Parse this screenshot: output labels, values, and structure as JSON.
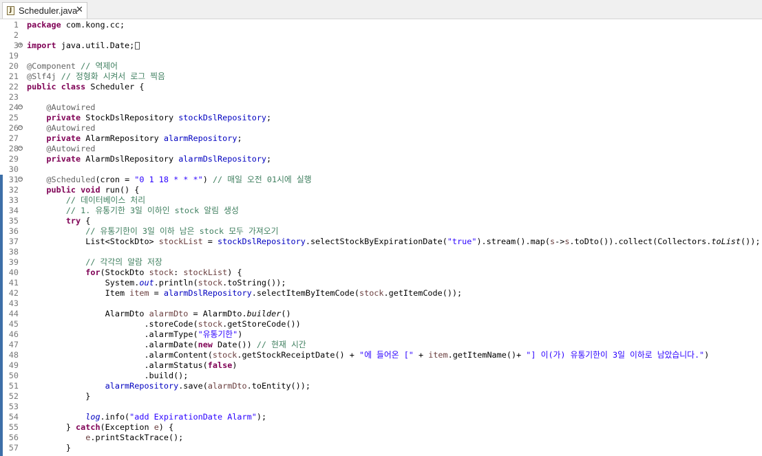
{
  "tab": {
    "icon": "java-file-icon",
    "icon_glyph": "J",
    "title": "Scheduler.java",
    "close": "✕"
  },
  "lines": [
    {
      "n": "1",
      "fold": "",
      "html": "<span class=\"kw\">package</span> com.kong.cc;"
    },
    {
      "n": "2",
      "fold": "",
      "html": ""
    },
    {
      "n": "3",
      "fold": "+",
      "html": "<span class=\"kw\">import</span> java.util.Date;<span class=\"boxmark\"></span>"
    },
    {
      "n": "19",
      "fold": "",
      "html": ""
    },
    {
      "n": "20",
      "fold": "",
      "html": "<span class=\"ann\">@Component</span> <span class=\"cm\">// 역제어</span>"
    },
    {
      "n": "21",
      "fold": "",
      "html": "<span class=\"ann\">@Slf4j</span> <span class=\"cm\">// 정형화 시켜서 로그 찍음</span>"
    },
    {
      "n": "22",
      "fold": "",
      "html": "<span class=\"kw\">public class</span> Scheduler {"
    },
    {
      "n": "23",
      "fold": "",
      "html": ""
    },
    {
      "n": "24",
      "fold": "−",
      "html": "    <span class=\"ann\">@Autowired</span>"
    },
    {
      "n": "25",
      "fold": "",
      "html": "    <span class=\"kw\">private</span> StockDslRepository <span class=\"fld\">stockDslRepository</span>;"
    },
    {
      "n": "26",
      "fold": "−",
      "html": "    <span class=\"ann\">@Autowired</span>"
    },
    {
      "n": "27",
      "fold": "",
      "html": "    <span class=\"kw\">private</span> AlarmRepository <span class=\"fld\">alarmRepository</span>;"
    },
    {
      "n": "28",
      "fold": "−",
      "html": "    <span class=\"ann\">@Autowired</span>"
    },
    {
      "n": "29",
      "fold": "",
      "html": "    <span class=\"kw\">private</span> AlarmDslRepository <span class=\"fld\">alarmDslRepository</span>;"
    },
    {
      "n": "30",
      "fold": "",
      "html": ""
    },
    {
      "n": "31",
      "fold": "−",
      "html": "    <span class=\"ann\">@Scheduled</span>(cron = <span class=\"str\">\"0 1 18 * * *\"</span>) <span class=\"cm\">// 매일 오전 01시에 실행</span>"
    },
    {
      "n": "32",
      "fold": "",
      "html": "    <span class=\"kw\">public void</span> run() {"
    },
    {
      "n": "33",
      "fold": "",
      "html": "        <span class=\"cm\">// 데이터베이스 처리</span>"
    },
    {
      "n": "34",
      "fold": "",
      "html": "        <span class=\"cm\">// 1. 유통기한 3일 이하인 stock 알림 생성</span>"
    },
    {
      "n": "35",
      "fold": "",
      "html": "        <span class=\"kw\">try</span> {"
    },
    {
      "n": "36",
      "fold": "",
      "html": "            <span class=\"cm\">// 유통기한이 3일 이하 남은 stock 모두 가져오기</span>"
    },
    {
      "n": "37",
      "fold": "",
      "html": "            List&lt;StockDto&gt; <span class=\"local\">stockList</span> = <span class=\"fld\">stockDslRepository</span>.selectStockByExpirationDate(<span class=\"str\">\"true\"</span>).stream().map(<span class=\"local\">s</span>-&gt;<span class=\"local\">s</span>.toDto()).collect(Collectors.<span class=\"it\">toList</span>());"
    },
    {
      "n": "38",
      "fold": "",
      "html": ""
    },
    {
      "n": "39",
      "fold": "",
      "html": "            <span class=\"cm\">// 각각의 알람 저장</span>"
    },
    {
      "n": "40",
      "fold": "",
      "html": "            <span class=\"kw\">for</span>(StockDto <span class=\"local\">stock</span>: <span class=\"local\">stockList</span>) {"
    },
    {
      "n": "41",
      "fold": "",
      "html": "                System.<span class=\"fld it\">out</span>.println(<span class=\"local\">stock</span>.toString());"
    },
    {
      "n": "42",
      "fold": "",
      "html": "                Item <span class=\"local\">item</span> = <span class=\"fld\">alarmDslRepository</span>.selectItemByItemCode(<span class=\"local\">stock</span>.getItemCode());"
    },
    {
      "n": "43",
      "fold": "",
      "html": ""
    },
    {
      "n": "44",
      "fold": "",
      "html": "                AlarmDto <span class=\"local\">alarmDto</span> = AlarmDto.<span class=\"it\">builder</span>()"
    },
    {
      "n": "45",
      "fold": "",
      "html": "                        .storeCode(<span class=\"local\">stock</span>.getStoreCode())"
    },
    {
      "n": "46",
      "fold": "",
      "html": "                        .alarmType(<span class=\"str\">\"유통기한\"</span>)"
    },
    {
      "n": "47",
      "fold": "",
      "html": "                        .alarmDate(<span class=\"kw\">new</span> Date()) <span class=\"cm\">// 현재 시간</span>"
    },
    {
      "n": "48",
      "fold": "",
      "html": "                        .alarmContent(<span class=\"local\">stock</span>.getStockReceiptDate() + <span class=\"str\">\"에 들어온 [\"</span> + <span class=\"local\">item</span>.getItemName()+ <span class=\"str\">\"] 이(가) 유통기한이 3일 이하로 남았습니다.\"</span>)"
    },
    {
      "n": "49",
      "fold": "",
      "html": "                        .alarmStatus(<span class=\"kw\">false</span>)"
    },
    {
      "n": "50",
      "fold": "",
      "html": "                        .build();"
    },
    {
      "n": "51",
      "fold": "",
      "html": "                <span class=\"fld\">alarmRepository</span>.save(<span class=\"local\">alarmDto</span>.toEntity());"
    },
    {
      "n": "52",
      "fold": "",
      "html": "            }"
    },
    {
      "n": "53",
      "fold": "",
      "html": ""
    },
    {
      "n": "54",
      "fold": "",
      "html": "            <span class=\"fld it\">log</span>.info(<span class=\"str\">\"add ExpirationDate Alarm\"</span>);"
    },
    {
      "n": "55",
      "fold": "",
      "html": "        } <span class=\"kw\">catch</span>(Exception <span class=\"local\">e</span>) {"
    },
    {
      "n": "56",
      "fold": "",
      "html": "            <span class=\"local\">e</span>.printStackTrace();"
    },
    {
      "n": "57",
      "fold": "",
      "html": "        }"
    }
  ]
}
